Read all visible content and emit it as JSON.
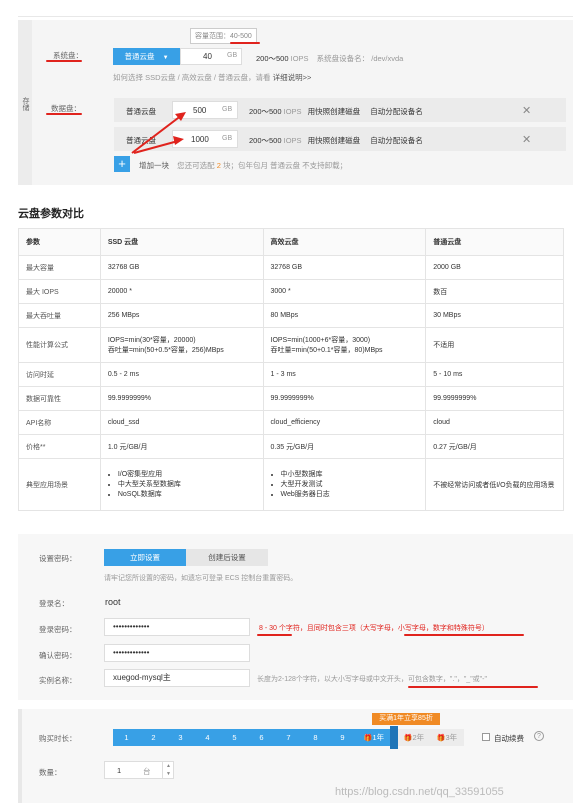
{
  "storage": {
    "section_label": "存储",
    "system_disk": {
      "label": "系统盘：",
      "type_button": "普通云盘",
      "size_value": "40",
      "unit": "GB",
      "iops": "200～500",
      "iops_unit": "IOPS",
      "device_label": "系统盘设备名：",
      "device_value": "/dev/xvda",
      "tooltip_prefix": "容量范围：",
      "tooltip_range": "40-500",
      "help_text": "如何选择 SSD云盘 / 高效云盘 / 普通云盘，请看",
      "help_link": "详细说明>>"
    },
    "data_disk": {
      "label": "数据盘：",
      "rows": [
        {
          "type": "普通云盘",
          "size": "500",
          "unit": "GB",
          "iops": "200～500",
          "iops_unit": "IOPS",
          "snapshot": "用快照创建磁盘",
          "device": "自动分配设备名",
          "close": "✕"
        },
        {
          "type": "普通云盘",
          "size": "1000",
          "unit": "GB",
          "iops": "200～500",
          "iops_unit": "IOPS",
          "snapshot": "用快照创建磁盘",
          "device": "自动分配设备名",
          "close": "✕"
        }
      ],
      "add_icon": "+",
      "add_label": "增加一块",
      "add_note_prefix": "您还可选配",
      "add_note_count": "2",
      "add_note_suffix": "块；包年包月 普通云盘 不支持卸载；"
    }
  },
  "comparison": {
    "title": "云盘参数对比",
    "headers": [
      "参数",
      "SSD 云盘",
      "高效云盘",
      "普通云盘"
    ],
    "rows": [
      {
        "param": "最大容量",
        "ssd": "32768 GB",
        "efficiency": "32768 GB",
        "basic": "2000 GB"
      },
      {
        "param": "最大 IOPS",
        "ssd": "20000 *",
        "efficiency": "3000 *",
        "basic": "数百"
      },
      {
        "param": "最大吞吐量",
        "ssd": "256 MBps",
        "efficiency": "80 MBps",
        "basic": "30 MBps"
      },
      {
        "param": "性能计算公式",
        "ssd": "IOPS=min(30*容量，20000)",
        "ssd2": "吞吐量=min(50+0.5*容量，256)MBps",
        "efficiency": "IOPS=min(1000+6*容量，3000)",
        "efficiency2": "吞吐量=min(50+0.1*容量，80)MBps",
        "basic": "不适用"
      },
      {
        "param": "访问时延",
        "ssd": "0.5 - 2 ms",
        "efficiency": "1 - 3 ms",
        "basic": "5 - 10 ms"
      },
      {
        "param": "数据可靠性",
        "ssd": "99.9999999%",
        "efficiency": "99.9999999%",
        "basic": "99.9999999%"
      },
      {
        "param": "API名称",
        "ssd": "cloud_ssd",
        "efficiency": "cloud_efficiency",
        "basic": "cloud"
      },
      {
        "param": "价格**",
        "ssd": "1.0 元/GB/月",
        "efficiency": "0.35 元/GB/月",
        "basic": "0.27 元/GB/月"
      }
    ],
    "scenario": {
      "param": "典型应用场景",
      "ssd": [
        "I/O密集型应用",
        "中大型关系型数据库",
        "NoSQL数据库"
      ],
      "efficiency": [
        "中小型数据库",
        "大型开发测试",
        "Web服务器日志"
      ],
      "basic": "不被经常访问或者低I/O负载的应用场景"
    }
  },
  "password": {
    "label": "设置密码：",
    "tab_now": "立即设置",
    "tab_later": "创建后设置",
    "note": "请牢记您所设置的密码，如遗忘可登录 ECS 控制台重置密码。",
    "login_name_label": "登录名：",
    "login_name_value": "root",
    "login_pw_label": "登录密码：",
    "login_pw_value": "•••••••••••••",
    "login_pw_hint": "8 - 30 个字符，且同时包含三项（大写字母，小写字母，数字和特殊符号）",
    "confirm_pw_label": "确认密码：",
    "confirm_pw_value": "•••••••••••••",
    "instance_label": "实例名称：",
    "instance_value": "xuegod-mysql主",
    "instance_hint": "长度为2-128个字符，以大小写字母或中文开头，可包含数字，\".\"，\"_\"或\"-\""
  },
  "purchase": {
    "duration_label": "购买时长：",
    "months": [
      "1",
      "2",
      "3",
      "4",
      "5",
      "6",
      "7",
      "8",
      "9"
    ],
    "promo": "买满1年立享85折",
    "year1": "1年",
    "year2": "2年",
    "year3": "3年",
    "auto_renew": "自动续费",
    "help_icon": "?",
    "qty_label": "数量：",
    "qty_value": "1",
    "qty_unit": "台",
    "watermark": "https://blog.csdn.net/qq_33591055"
  },
  "colors": {
    "accent": "#38a0e6",
    "annotation": "#e0231d",
    "promo": "#f08a24"
  }
}
